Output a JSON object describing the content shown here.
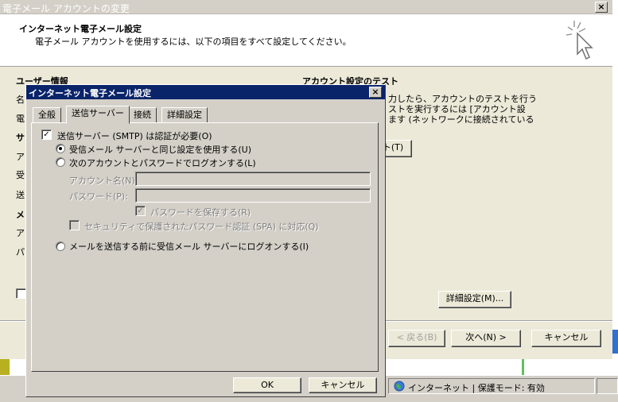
{
  "outer": {
    "title": "電子メール アカウントの変更",
    "header_title": "インターネット電子メール設定",
    "header_subtitle": "電子メール アカウントを使用するには、以下の項目をすべて設定してください。",
    "user_info_label": "ユーザー情報",
    "test_label": "アカウント設定のテスト",
    "test_desc_1": "力したら、アカウントのテストを行う",
    "test_desc_2": "ストを実行するには [アカウント設",
    "test_desc_3": "ます (ネットワークに接続されている",
    "test_button_tail": "ト(T)",
    "left_letters": [
      "名",
      "電",
      "サ",
      "ア",
      "受",
      "送",
      "メ",
      "ア",
      "パ"
    ],
    "more_settings": "詳細設定(M)...",
    "back": "< 戻る(B)",
    "next": "次へ(N) >",
    "cancel": "キャンセル"
  },
  "dialog": {
    "title": "インターネット電子メール設定",
    "tabs": [
      "全般",
      "送信サーバー",
      "接続",
      "詳細設定"
    ],
    "active_tab": "送信サーバー",
    "smtp_auth": "送信サーバー (SMTP) は認証が必要(O)",
    "same_as_incoming": "受信メール サーバーと同じ設定を使用する(U)",
    "logon_with": "次のアカウントとパスワードでログオンする(L)",
    "account_name": "アカウント名(N):",
    "password": "パスワード(P):",
    "remember_password": "パスワードを保存する(R)",
    "spa": "セキュリティで保護されたパスワード認証 (SPA) に対応(Q)",
    "logon_before_send": "メールを送信する前に受信メール サーバーにログオンする(I)",
    "ok": "OK",
    "cancel": "キャンセル"
  },
  "statusbar": {
    "zone": "インターネット | 保護モード: 有効"
  }
}
